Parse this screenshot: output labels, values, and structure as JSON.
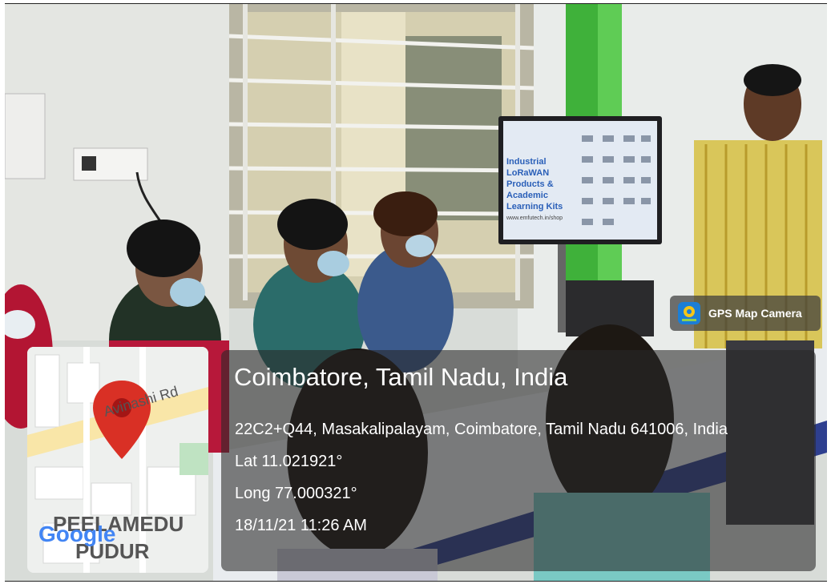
{
  "tv_slide": {
    "line1": "Industrial LoRaWAN",
    "line2": "Products &",
    "line3": "Academic Learning Kits",
    "url": "www.emfutech.in/shop"
  },
  "gps": {
    "app_name": "GPS Map Camera",
    "location_title": "Coimbatore, Tamil Nadu, India",
    "address": "22C2+Q44, Masakalipalayam, Coimbatore, Tamil Nadu 641006, India",
    "latitude": "Lat 11.021921°",
    "longitude": "Long 77.000321°",
    "datetime": "18/11/21 11:26 AM"
  },
  "map": {
    "road_label": "Avinashi Rd",
    "area_label_1": "PEELAMEDU",
    "area_label_2": "PUDUR",
    "brand": "Google",
    "pin_color": "#d93025"
  }
}
